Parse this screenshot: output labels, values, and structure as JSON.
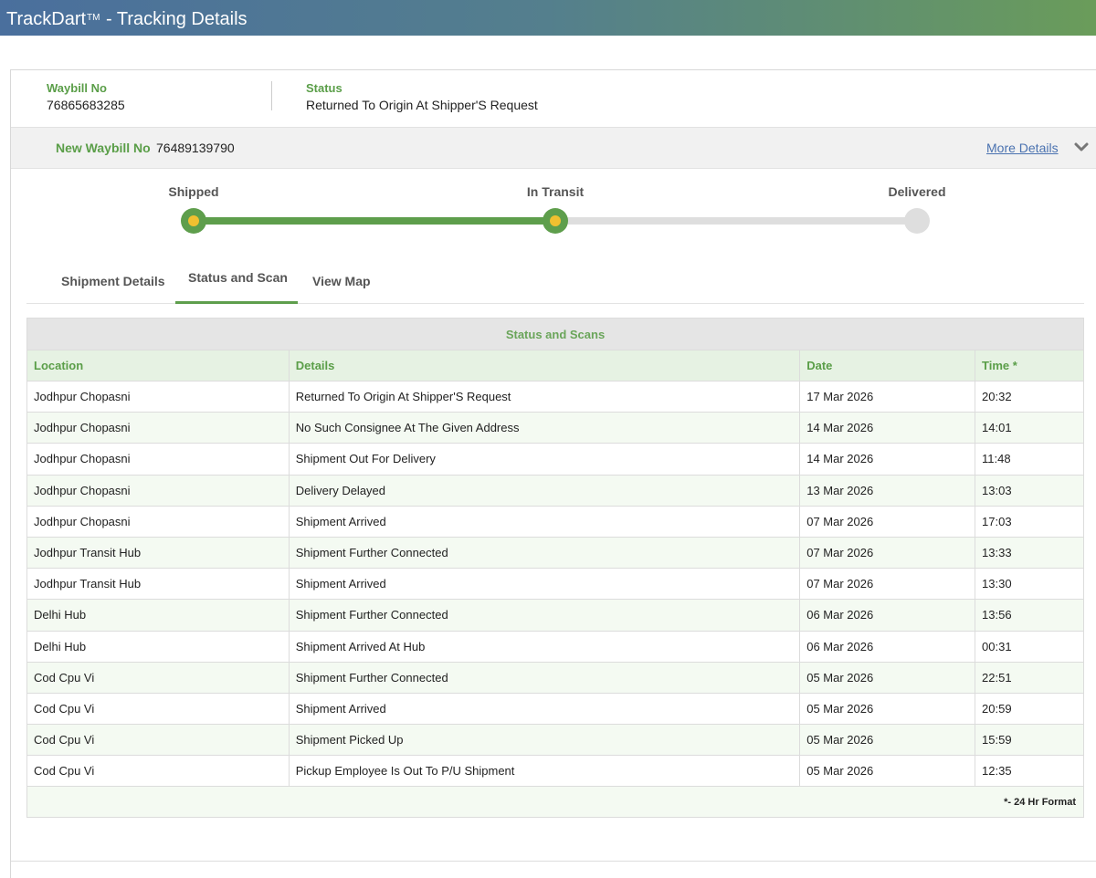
{
  "app": {
    "brand": "TrackDart",
    "trademark": "TM",
    "title_suffix": " - Tracking Details"
  },
  "summary": {
    "waybill_label": "Waybill No",
    "waybill_value": "76865683285",
    "status_label": "Status",
    "status_value": "Returned To Origin At Shipper'S Request"
  },
  "new_waybill": {
    "label": "New Waybill No",
    "value": "76489139790",
    "more_details_label": "More Details",
    "toggle_icon": "chevron-down-icon"
  },
  "progress": {
    "steps": [
      {
        "label": "Shipped",
        "state": "done"
      },
      {
        "label": "In Transit",
        "state": "done"
      },
      {
        "label": "Delivered",
        "state": "pending"
      }
    ],
    "completed_fraction": 0.5,
    "colors": {
      "done": "#5e9e4c",
      "pending": "#dedede",
      "dot_center": "#f0c030"
    }
  },
  "tabs": [
    {
      "label": "Shipment Details",
      "active": false
    },
    {
      "label": "Status and Scan",
      "active": true
    },
    {
      "label": "View Map",
      "active": false
    }
  ],
  "scans": {
    "caption": "Status and Scans",
    "columns": [
      "Location",
      "Details",
      "Date",
      "Time *"
    ],
    "rows": [
      [
        "Jodhpur Chopasni",
        "Returned To Origin At Shipper'S Request",
        "17 Mar 2026",
        "20:32"
      ],
      [
        "Jodhpur Chopasni",
        "No Such Consignee At The Given Address",
        "14 Mar 2026",
        "14:01"
      ],
      [
        "Jodhpur Chopasni",
        "Shipment Out For Delivery",
        "14 Mar 2026",
        "11:48"
      ],
      [
        "Jodhpur Chopasni",
        "Delivery Delayed",
        "13 Mar 2026",
        "13:03"
      ],
      [
        "Jodhpur Chopasni",
        "Shipment Arrived",
        "07 Mar 2026",
        "17:03"
      ],
      [
        "Jodhpur Transit Hub",
        "Shipment Further Connected",
        "07 Mar 2026",
        "13:33"
      ],
      [
        "Jodhpur Transit Hub",
        "Shipment Arrived",
        "07 Mar 2026",
        "13:30"
      ],
      [
        "Delhi Hub",
        "Shipment Further Connected",
        "06 Mar 2026",
        "13:56"
      ],
      [
        "Delhi Hub",
        "Shipment Arrived At Hub",
        "06 Mar 2026",
        "00:31"
      ],
      [
        "Cod Cpu Vi",
        "Shipment Further Connected",
        "05 Mar 2026",
        "22:51"
      ],
      [
        "Cod Cpu Vi",
        "Shipment Arrived",
        "05 Mar 2026",
        "20:59"
      ],
      [
        "Cod Cpu Vi",
        "Shipment Picked Up",
        "05 Mar 2026",
        "15:59"
      ],
      [
        "Cod Cpu Vi",
        "Pickup Employee Is Out To P/U Shipment",
        "05 Mar 2026",
        "12:35"
      ]
    ],
    "footnote": "*- 24 Hr Format"
  }
}
